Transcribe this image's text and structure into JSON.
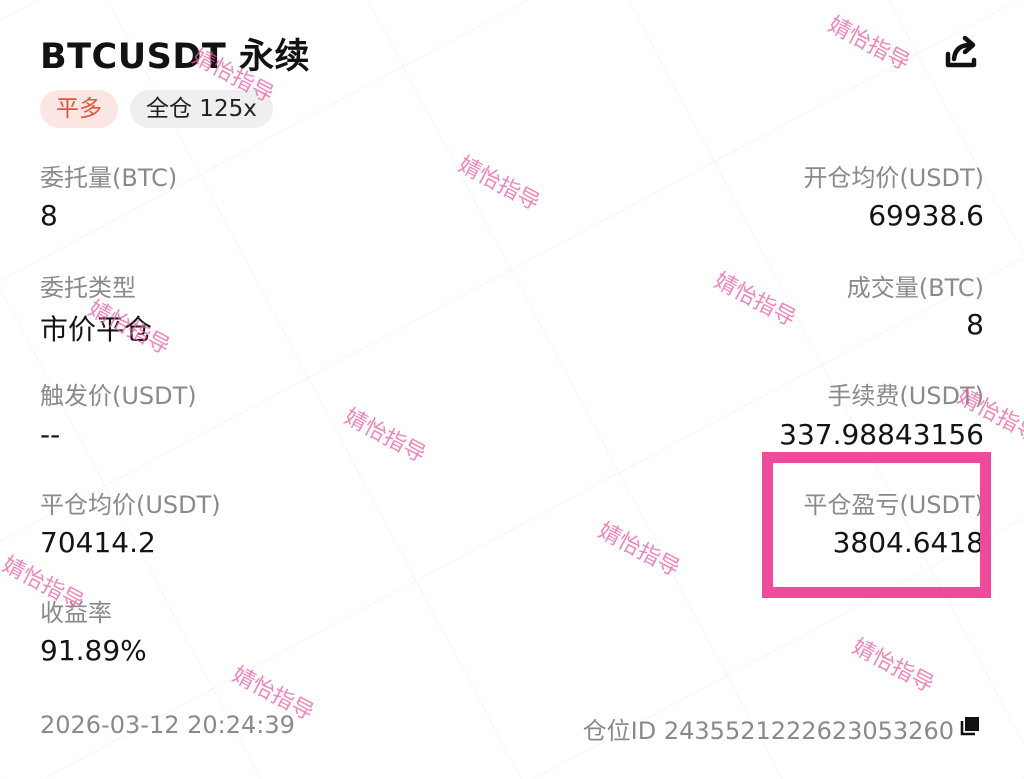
{
  "header": {
    "title": "BTCUSDT 永续",
    "badges": {
      "side": "平多",
      "margin": "全仓 125x"
    }
  },
  "fields": {
    "order_qty": {
      "label": "委托量(BTC)",
      "value": "8"
    },
    "open_avg": {
      "label": "开仓均价(USDT)",
      "value": "69938.6"
    },
    "order_type": {
      "label": "委托类型",
      "value": "市价平仓"
    },
    "filled_qty": {
      "label": "成交量(BTC)",
      "value": "8"
    },
    "trigger_price": {
      "label": "触发价(USDT)",
      "value": "--"
    },
    "fee": {
      "label": "手续费(USDT)",
      "value": "337.98843156"
    },
    "close_avg": {
      "label": "平仓均价(USDT)",
      "value": "70414.2"
    },
    "close_pnl": {
      "label": "平仓盈亏(USDT)",
      "value": "3804.6418"
    },
    "roi": {
      "label": "收益率",
      "value": "91.89%"
    }
  },
  "footer": {
    "time": "2026-03-12 20:24:39",
    "position_id": "仓位ID 2435521222623053260"
  },
  "watermark": "婧怡指导",
  "colors": {
    "side_badge_bg": "#fbe6e4",
    "side_badge_text": "#e0553f",
    "highlight": "#ee4b9c",
    "watermark": "#e95ea6"
  },
  "icons": {
    "share": "share-icon",
    "copy": "copy-icon"
  }
}
